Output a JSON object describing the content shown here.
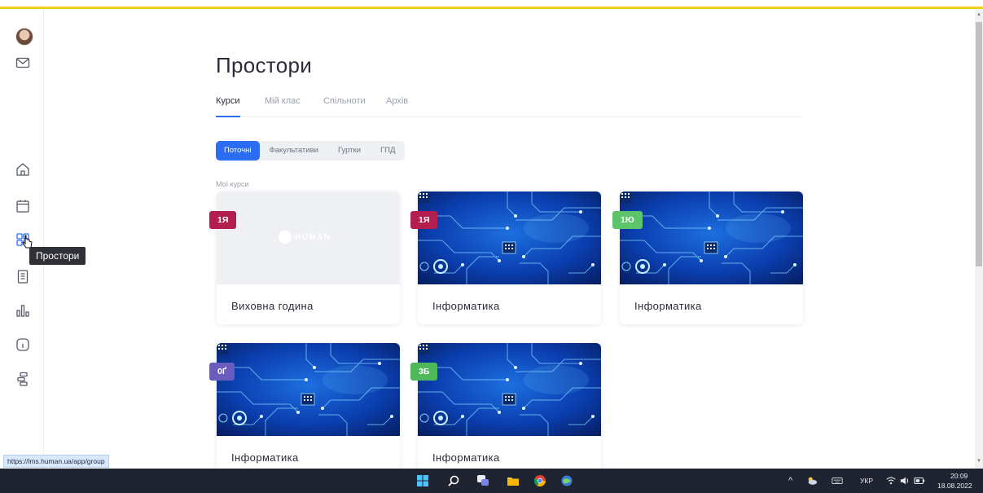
{
  "page_title": "Простори",
  "tabs": [
    {
      "label": "Курси",
      "active": true
    },
    {
      "label": "Мій клас",
      "active": false
    },
    {
      "label": "Спільноти",
      "active": false
    },
    {
      "label": "Архів",
      "active": false
    }
  ],
  "filters": [
    {
      "label": "Поточні",
      "active": true
    },
    {
      "label": "Факультативи",
      "active": false
    },
    {
      "label": "Гуртки",
      "active": false
    },
    {
      "label": "ГПД",
      "active": false
    }
  ],
  "section_label": "Мої курси",
  "courses": [
    {
      "badge": "1Я",
      "badge_color": "#b31e4e",
      "title": "Виховна година",
      "image": "placeholder",
      "logo_text": "HUMAN"
    },
    {
      "badge": "1Я",
      "badge_color": "#b31e4e",
      "title": "Інформатика",
      "image": "circuit-board"
    },
    {
      "badge": "1Ю",
      "badge_color": "#5cc46a",
      "title": "Інформатика",
      "image": "circuit-board"
    },
    {
      "badge": "0Ґ",
      "badge_color": "#6a5bbf",
      "title": "Інформатика",
      "image": "circuit-board"
    },
    {
      "badge": "3Б",
      "badge_color": "#4fb85a",
      "title": "Інформатика",
      "image": "circuit-board"
    }
  ],
  "sidebar": {
    "tooltip": "Простори",
    "icons": [
      "avatar",
      "mail-icon",
      "home-icon",
      "calendar-icon",
      "spaces-icon",
      "clipboard-icon",
      "chart-icon",
      "info-icon",
      "structure-icon"
    ]
  },
  "status_url": "https://lms.human.ua/app/group",
  "taskbar": {
    "language": "УКР",
    "time": "20:09",
    "date": "18.08.2022"
  },
  "colors": {
    "accent": "#2a6cf2",
    "top_stripe": "#f2cf1d"
  }
}
